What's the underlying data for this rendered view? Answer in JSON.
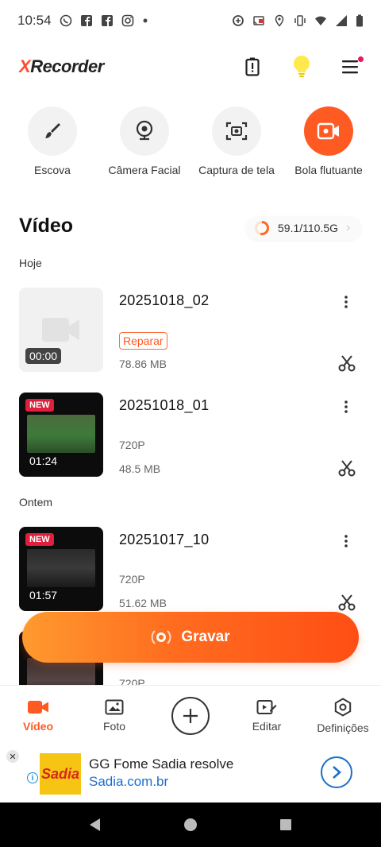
{
  "status_bar": {
    "time": "10:54",
    "left_icons": [
      "whatsapp-icon",
      "facebook-icon",
      "facebook-icon",
      "instagram-icon",
      "dot-icon"
    ],
    "right_icons": [
      "data-saver-icon",
      "cast-icon",
      "location-icon",
      "vibrate-icon",
      "wifi-icon",
      "signal-icon",
      "battery-icon"
    ]
  },
  "header": {
    "logo_prefix": "X",
    "logo_rest": "Recorder",
    "actions": [
      "battery-alert-icon",
      "lightbulb-icon",
      "menu-icon"
    ]
  },
  "tools": [
    {
      "label": "Escova",
      "icon": "brush-icon"
    },
    {
      "label": "Câmera Facial",
      "icon": "webcam-icon"
    },
    {
      "label": "Captura de tela",
      "icon": "screenshot-icon"
    },
    {
      "label": "Bola flutuante",
      "icon": "floating-ball-icon"
    }
  ],
  "section": {
    "title": "Vídeo",
    "storage": "59.1/110.5G",
    "storage_used_fraction": 0.535
  },
  "days": {
    "today": "Hoje",
    "yesterday": "Ontem"
  },
  "videos": [
    {
      "title": "20251018_02",
      "duration": "00:00",
      "action": "Reparar",
      "size": "78.86 MB"
    },
    {
      "title": "20251018_01",
      "duration": "01:24",
      "badge": "NEW",
      "resolution": "720P",
      "size": "48.5 MB"
    },
    {
      "title": "20251017_10",
      "duration": "01:57",
      "badge": "NEW",
      "resolution": "720P",
      "size": "51.62 MB"
    },
    {
      "resolution": "720P"
    }
  ],
  "record_button": {
    "label": "Gravar"
  },
  "bottom_nav": [
    {
      "label": "Vídeo",
      "icon": "video-camera-icon",
      "active": true
    },
    {
      "label": "Foto",
      "icon": "photo-icon"
    },
    {
      "label": "",
      "icon": "add-icon"
    },
    {
      "label": "Editar",
      "icon": "edit-video-icon"
    },
    {
      "label": "Definições",
      "icon": "settings-icon"
    }
  ],
  "ad": {
    "brand": "Sadia",
    "title": "GG Fome Sadia resolve",
    "url": "Sadia.com.br"
  },
  "colors": {
    "accent": "#ff5a22",
    "badge_red": "#e01f3d",
    "link_blue": "#1a6fcc"
  }
}
